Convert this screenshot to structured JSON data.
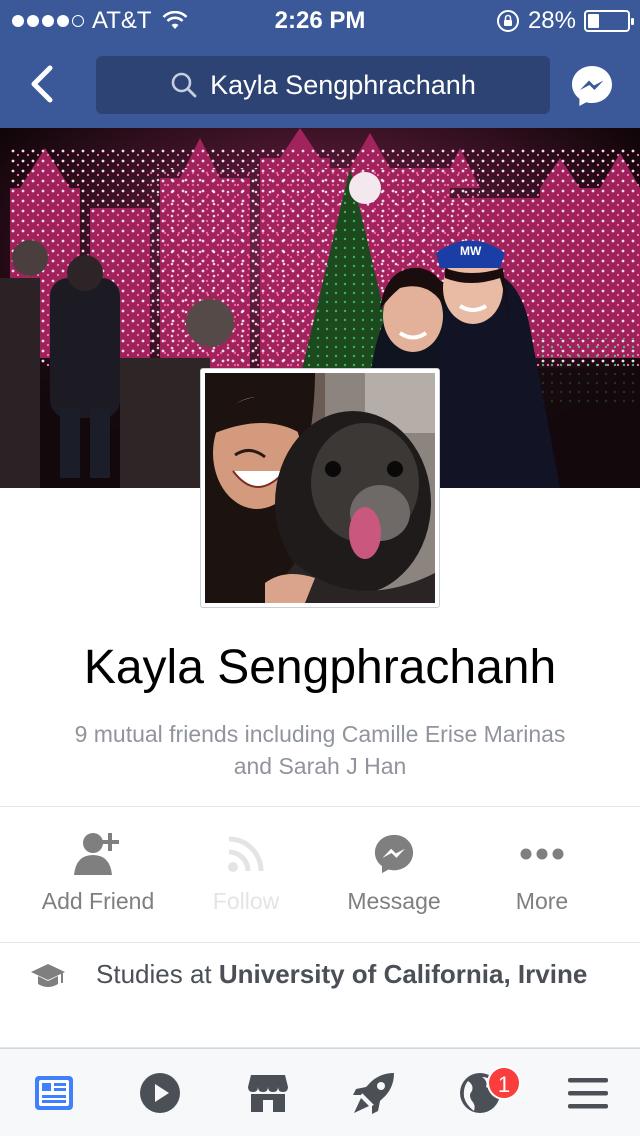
{
  "status_bar": {
    "carrier": "AT&T",
    "time": "2:26 PM",
    "battery_percent": "28%",
    "battery_level": 0.28,
    "signal_bars_filled": 4,
    "signal_bars_total": 5
  },
  "nav": {
    "search_text": "Kayla Sengphrachanh",
    "back_icon": "chevron-left-icon",
    "messenger_icon": "messenger-icon"
  },
  "profile": {
    "name": "Kayla Sengphrachanh",
    "mutual_friends_line1": "9 mutual friends including Camille Erise Marinas",
    "mutual_friends_line2": "and Sarah J Han",
    "cap_label": "MW"
  },
  "actions": [
    {
      "label": "Add Friend",
      "icon": "add-friend-icon",
      "enabled": true
    },
    {
      "label": "Follow",
      "icon": "follow-icon",
      "enabled": false
    },
    {
      "label": "Message",
      "icon": "messenger-icon",
      "enabled": true
    },
    {
      "label": "More",
      "icon": "more-icon",
      "enabled": true
    }
  ],
  "studies": {
    "prefix": "Studies at ",
    "school": "University of California, Irvine"
  },
  "tab_bar": {
    "items": [
      {
        "name": "news-feed",
        "icon": "news-feed-icon",
        "active": true
      },
      {
        "name": "video",
        "icon": "play-icon",
        "active": false
      },
      {
        "name": "marketplace",
        "icon": "store-icon",
        "active": false
      },
      {
        "name": "explore",
        "icon": "rocket-icon",
        "active": false
      },
      {
        "name": "notifications",
        "icon": "globe-icon",
        "active": false
      },
      {
        "name": "menu",
        "icon": "hamburger-icon",
        "active": false
      }
    ],
    "notification_count": "1"
  },
  "colors": {
    "brand": "#3b5998",
    "icon_gray": "#4b4f56",
    "badge_red": "#fa3e3e"
  }
}
